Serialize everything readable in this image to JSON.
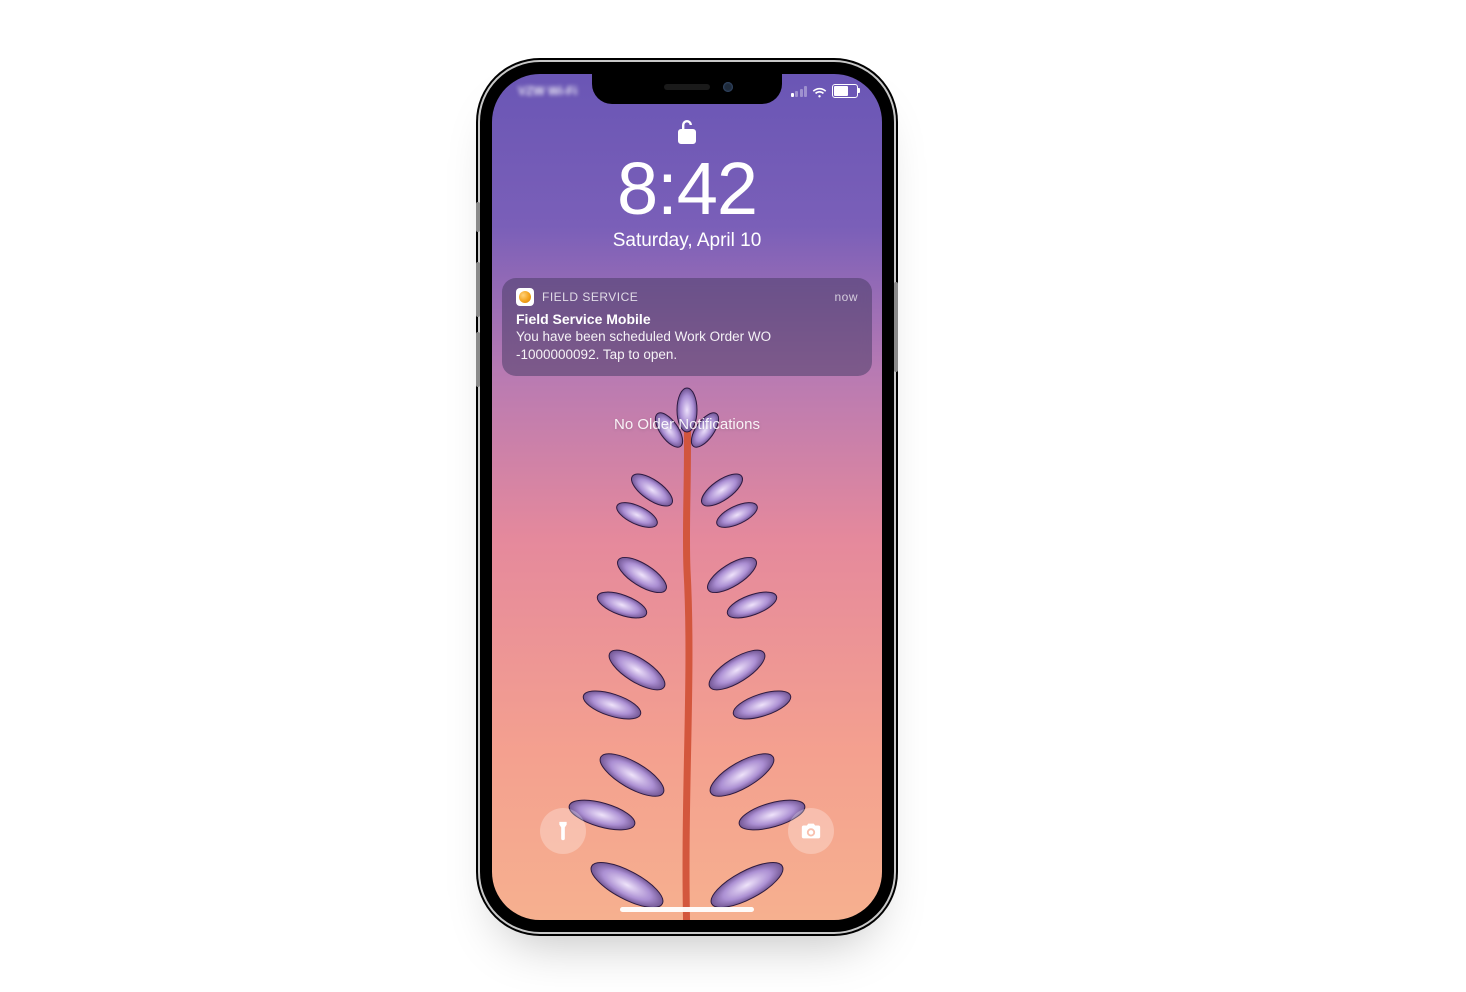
{
  "status_bar": {
    "carrier_blur_text": "VZW Wi-Fi"
  },
  "lock": {
    "time": "8:42",
    "date": "Saturday, April 10"
  },
  "notification": {
    "app_name": "FIELD SERVICE",
    "timestamp": "now",
    "title": "Field Service Mobile",
    "body": "You have been scheduled Work Order WO -1000000092. Tap to open."
  },
  "notifications_footer": "No Older Notifications"
}
